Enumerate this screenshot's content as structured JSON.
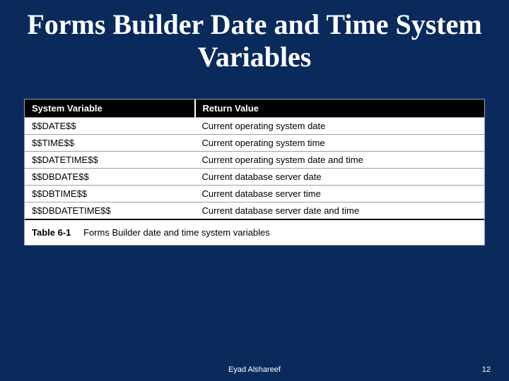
{
  "title": "Forms Builder Date and Time System Variables",
  "chart_data": {
    "type": "table",
    "headers": [
      "System Variable",
      "Return Value"
    ],
    "rows": [
      [
        "$$DATE$$",
        "Current operating system date"
      ],
      [
        "$$TIME$$",
        "Current operating system time"
      ],
      [
        "$$DATETIME$$",
        "Current operating system date and time"
      ],
      [
        "$$DBDATE$$",
        "Current database server date"
      ],
      [
        "$$DBTIME$$",
        "Current database server time"
      ],
      [
        "$$DBDATETIME$$",
        "Current database server date and time"
      ]
    ],
    "caption_label": "Table 6-1",
    "caption_text": "Forms Builder date and time system variables"
  },
  "footer": {
    "author": "Eyad Alshareef",
    "page_number": "12"
  }
}
